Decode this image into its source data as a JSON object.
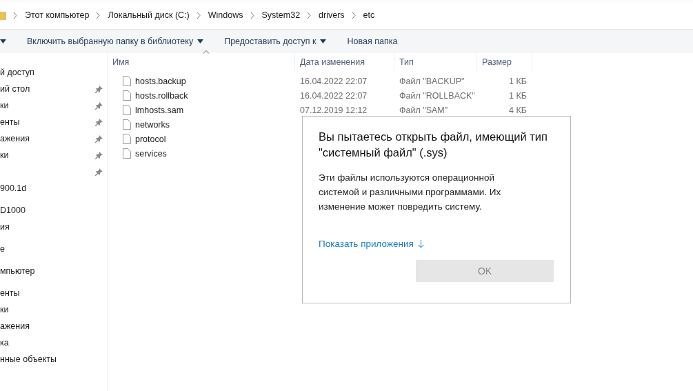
{
  "address_bar": {
    "crumbs": [
      "Этот компьютер",
      "Локальный диск (C:)",
      "Windows",
      "System32",
      "drivers",
      "etc"
    ]
  },
  "toolbar": {
    "items": [
      {
        "label": "Включить выбранную папку в библиотеку",
        "dropdown": true
      },
      {
        "label": "Предоставить доступ к",
        "dropdown": true
      },
      {
        "label": "Новая папка",
        "dropdown": false
      }
    ]
  },
  "sidebar": {
    "items": [
      {
        "label": "й доступ",
        "kind": "section",
        "pinned": false
      },
      {
        "label": "ий стол",
        "kind": "item",
        "pinned": true
      },
      {
        "label": "ки",
        "kind": "item",
        "pinned": true
      },
      {
        "label": "енты",
        "kind": "item",
        "pinned": true
      },
      {
        "label": "ажения",
        "kind": "item",
        "pinned": true
      },
      {
        "label": "ки",
        "kind": "item",
        "pinned": true
      },
      {
        "kind": "item",
        "pinned": true
      },
      {
        "label": "900.1d",
        "kind": "item",
        "pinned": false
      },
      {
        "label": "D1000",
        "kind": "section",
        "pinned": false
      },
      {
        "label": "ия",
        "kind": "item",
        "pinned": false
      },
      {
        "label": "е",
        "kind": "section",
        "pinned": false
      },
      {
        "label": "мпьютер",
        "kind": "section",
        "pinned": false
      },
      {
        "label": "енты",
        "kind": "section",
        "pinned": false
      },
      {
        "label": "ки",
        "kind": "item",
        "pinned": false
      },
      {
        "label": "ажения",
        "kind": "item",
        "pinned": false
      },
      {
        "label": "ка",
        "kind": "item",
        "pinned": false
      },
      {
        "label": "нные объекты",
        "kind": "item",
        "pinned": false
      }
    ]
  },
  "file_list": {
    "columns": [
      "Имя",
      "Дата изменения",
      "Тип",
      "Размер"
    ],
    "rows": [
      {
        "name": "hosts.backup",
        "date": "16.04.2022 22:07",
        "type": "Файл \"BACKUP\"",
        "size": "1 КБ"
      },
      {
        "name": "hosts.rollback",
        "date": "16.04.2022 22:07",
        "type": "Файл \"ROLLBACK\"",
        "size": "1 КБ"
      },
      {
        "name": "lmhosts.sam",
        "date": "07.12.2019 12:12",
        "type": "Файл \"SAM\"",
        "size": "4 КБ"
      },
      {
        "name": "networks"
      },
      {
        "name": "protocol"
      },
      {
        "name": "services"
      }
    ]
  },
  "dialog": {
    "title": "Вы пытаетесь открыть файл, имеющий тип \"системный файл\" (.sys)",
    "message": "Эти файлы используются операционной системой и различными программами. Их изменение может повредить систему.",
    "link": "Показать приложения",
    "button": {
      "label": "OK",
      "disabled": true
    }
  }
}
